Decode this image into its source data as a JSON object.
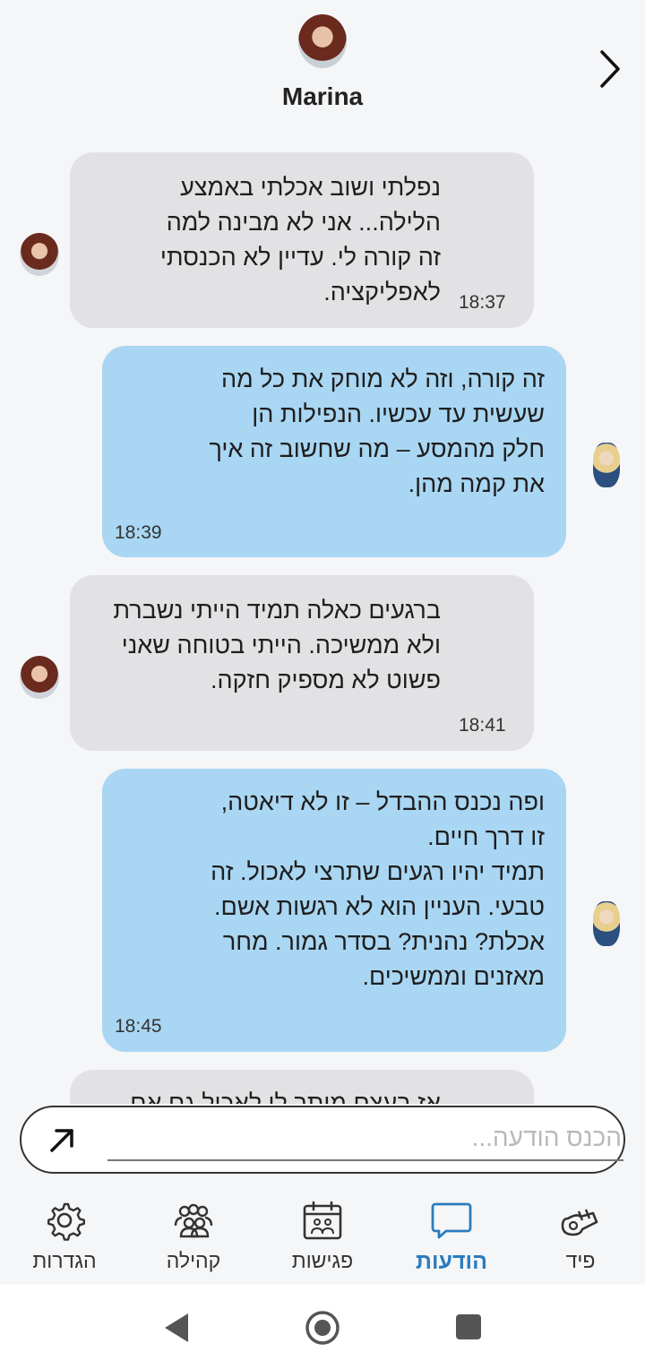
{
  "header": {
    "contact_name": "Marina",
    "back_icon": "chevron-right-icon"
  },
  "messages": [
    {
      "dir": "in",
      "text": "נפלתי ושוב אכלתי באמצע\nהלילה... אני לא מבינה למה\nזה קורה לי. עדיין לא הכנסתי\nלאפליקציה.",
      "time": "18:37"
    },
    {
      "dir": "out",
      "text": "זה קורה, וזה לא מוחק את כל מה\nשעשית עד עכשיו. הנפילות הן\nחלק מהמסע – מה שחשוב זה איך\nאת קמה מהן.",
      "time": "18:39"
    },
    {
      "dir": "in",
      "text": "ברגעים כאלה תמיד הייתי נשברת\nולא ממשיכה. הייתי בטוחה שאני\nפשוט לא מספיק חזקה.",
      "time": "18:41"
    },
    {
      "dir": "out",
      "text": "ופה נכנס ההבדל – זו לא דיאטה,\nזו דרך חיים.\nתמיד יהיו רגעים שתרצי לאכול. זה\nטבעי. העניין הוא לא רגשות אשם.\nאכלת? נהנית? בסדר גמור. מחר\nמאזנים וממשיכים.",
      "time": "18:45"
    },
    {
      "dir": "in",
      "text": "אז בעצם מותר לי לאכול גם אם",
      "time": ""
    }
  ],
  "composer": {
    "placeholder": "הכנס הודעה...",
    "send_icon": "send-arrow-icon"
  },
  "tabs": [
    {
      "id": "feed",
      "label": "פיד",
      "icon": "whistle-icon",
      "active": false
    },
    {
      "id": "messages",
      "label": "הודעות",
      "icon": "chat-bubble-icon",
      "active": true
    },
    {
      "id": "meetings",
      "label": "פגישות",
      "icon": "calendar-icon",
      "active": false
    },
    {
      "id": "community",
      "label": "קהילה",
      "icon": "people-icon",
      "active": false
    },
    {
      "id": "settings",
      "label": "הגדרות",
      "icon": "gear-icon",
      "active": false
    }
  ],
  "colors": {
    "accent": "#2b7bbd",
    "incoming_bubble": "#e2e2e4",
    "outgoing_bubble": "#a9d6f2",
    "background": "#f5f6f8"
  }
}
